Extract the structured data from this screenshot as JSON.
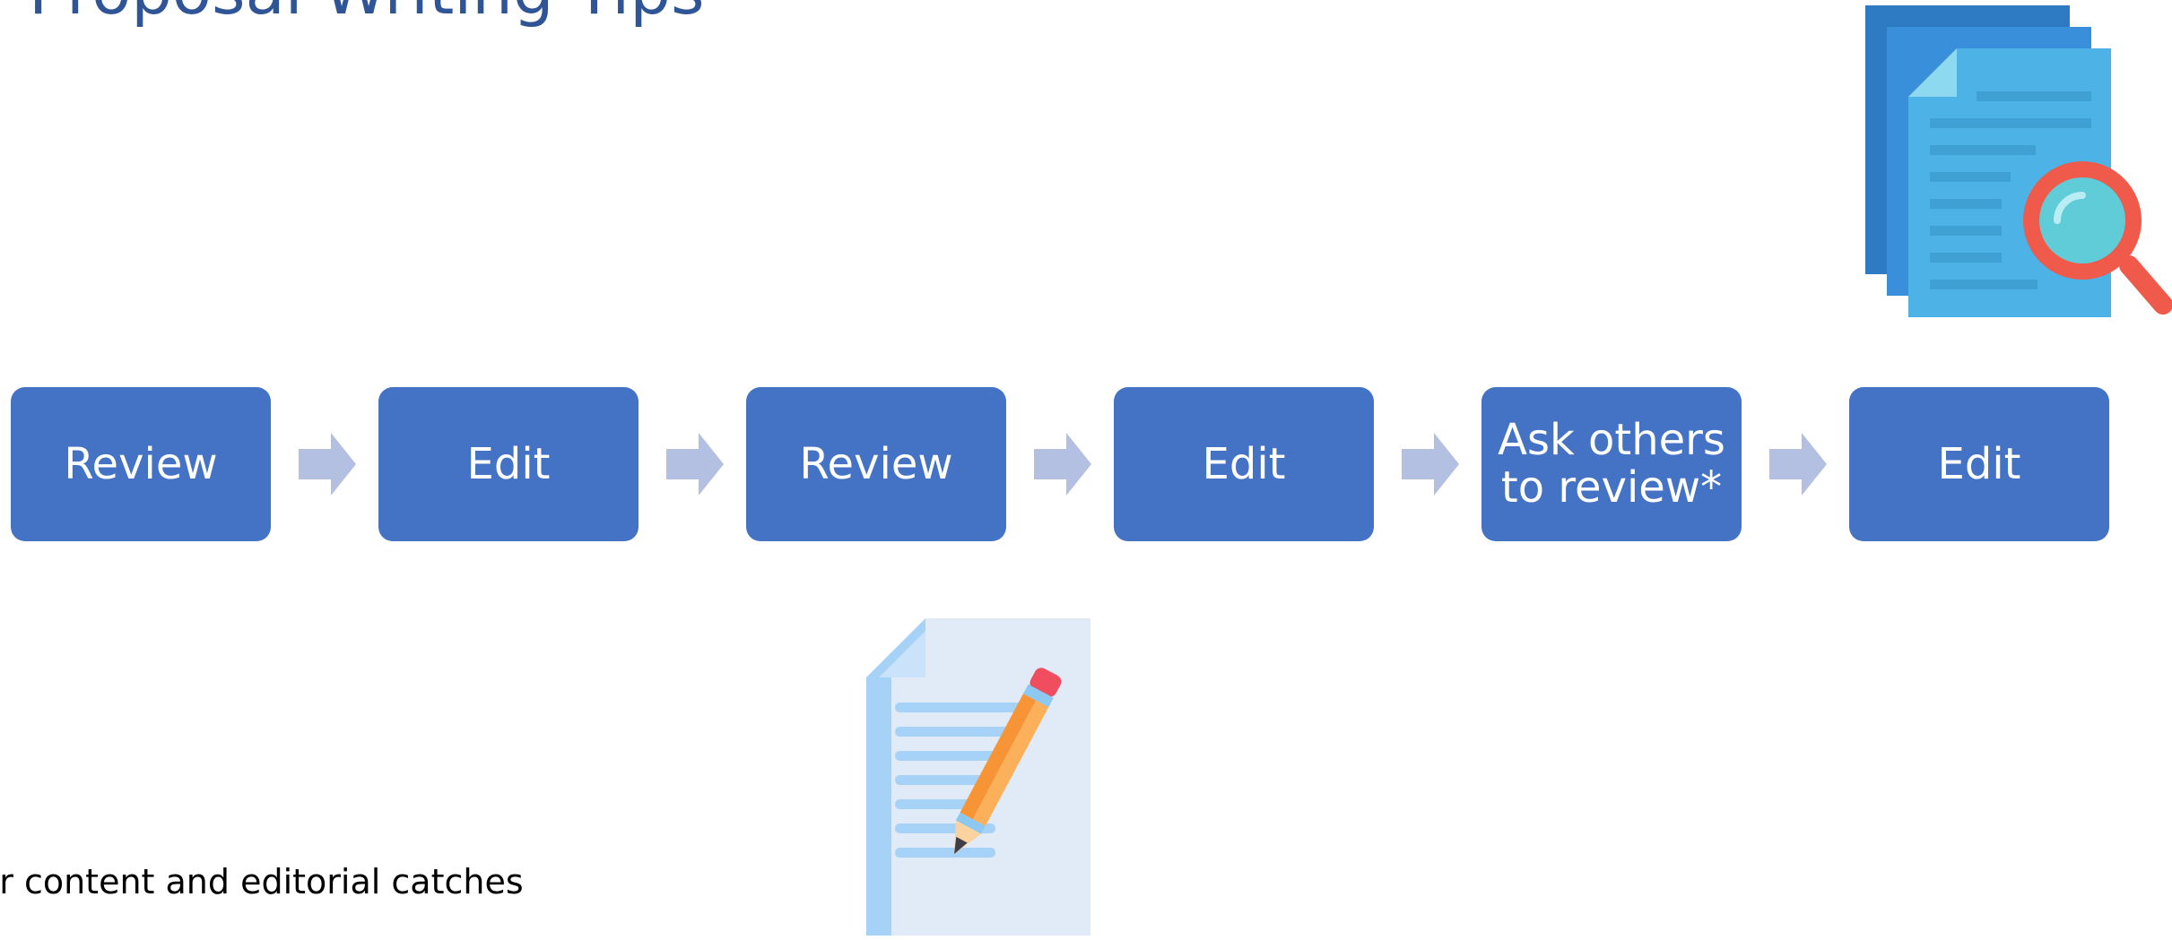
{
  "slide": {
    "title": "Proposal Writing Tips",
    "note": "or content and editorial catches"
  },
  "flow": {
    "steps": [
      {
        "label": "Review"
      },
      {
        "label": "Edit"
      },
      {
        "label": "Review"
      },
      {
        "label": "Edit"
      },
      {
        "label": "Ask others to review*"
      },
      {
        "label": "Edit"
      }
    ]
  },
  "colors": {
    "title": "#2F5597",
    "step_fill": "#4472C4",
    "arrow_fill": "#B4C0E2",
    "step_text": "#FFFFFF"
  },
  "icons": [
    "documents-magnifier-icon",
    "document-pencil-icon"
  ]
}
